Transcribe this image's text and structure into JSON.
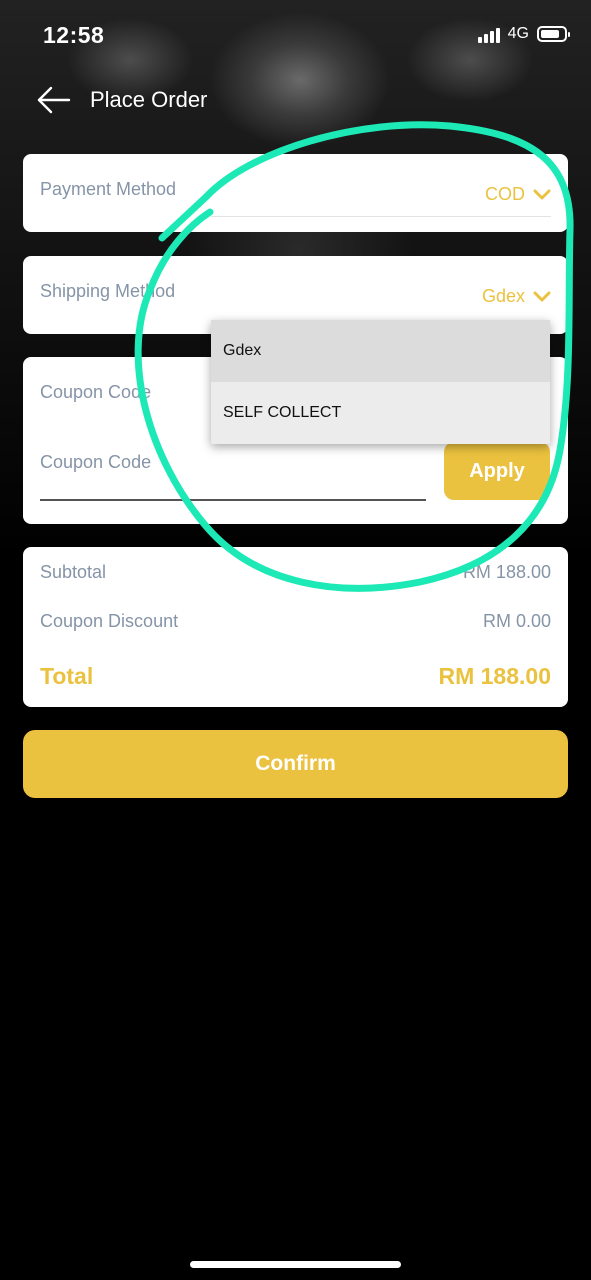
{
  "status_bar": {
    "time": "12:58",
    "network": "4G"
  },
  "nav": {
    "title": "Place Order"
  },
  "payment": {
    "label": "Payment Method",
    "value": "COD"
  },
  "shipping": {
    "label": "Shipping Method",
    "value": "Gdex",
    "options": [
      "Gdex",
      "SELF COLLECT"
    ]
  },
  "coupon": {
    "label": "Coupon Code",
    "placeholder": "Coupon Code",
    "apply_label": "Apply"
  },
  "summary": {
    "subtotal_label": "Subtotal",
    "subtotal_value": "RM 188.00",
    "discount_label": "Coupon Discount",
    "discount_value": "RM 0.00",
    "total_label": "Total",
    "total_value": "RM 188.00"
  },
  "confirm_label": "Confirm",
  "colors": {
    "accent": "#ebc23f",
    "annotation": "#1de9b6",
    "muted_text": "#8694a8"
  }
}
